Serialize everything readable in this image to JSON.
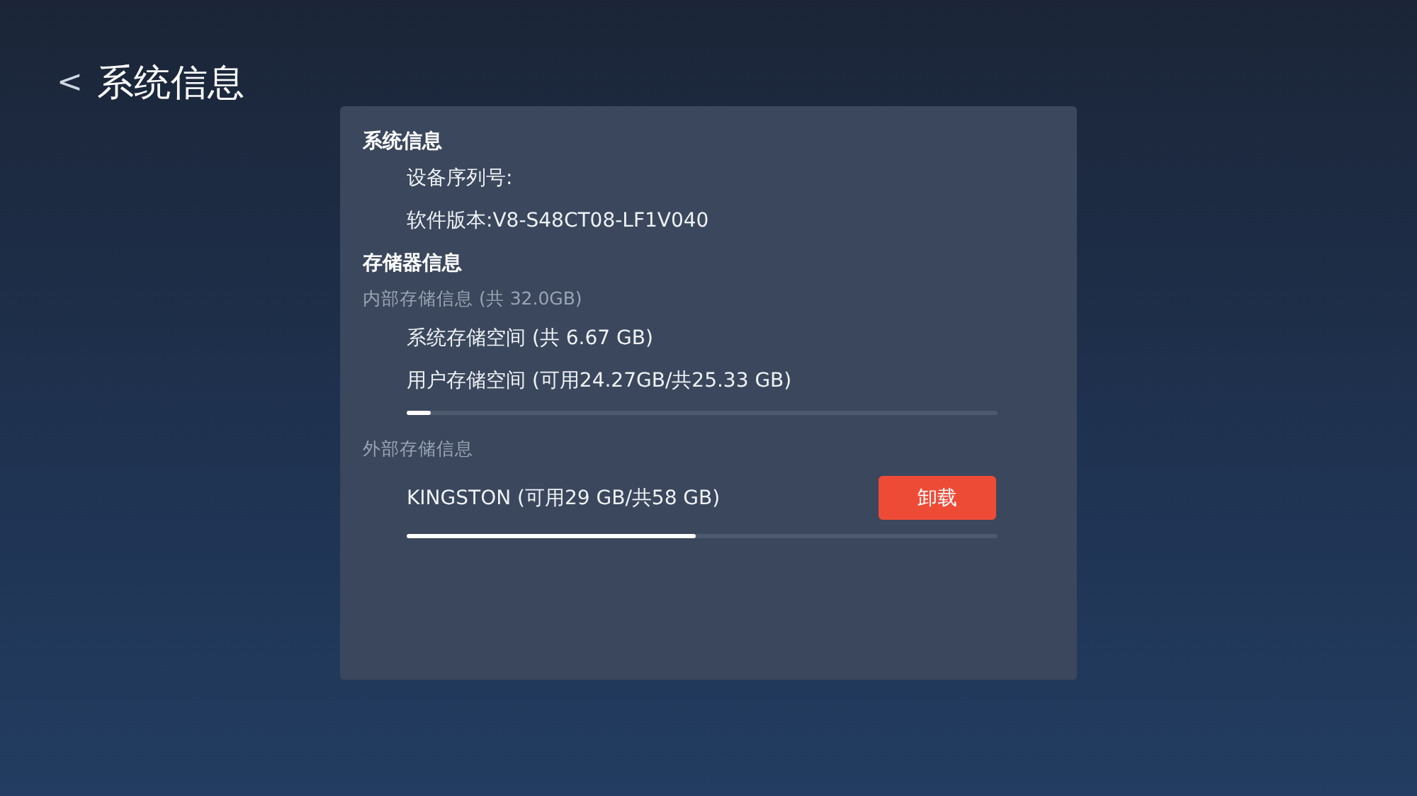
{
  "header": {
    "back": "<",
    "title": "系统信息"
  },
  "system": {
    "heading": "系统信息",
    "lines": [
      "设备序列号:",
      "软件版本:V8-S48CT08-LF1V040"
    ]
  },
  "storage": {
    "heading": "存储器信息",
    "internal": {
      "label": "内部存储信息 (共 32.0GB)",
      "lines": [
        "系统存储空间 (共 6.67 GB)",
        "用户存储空间 (可用24.27GB/共25.33 GB)"
      ],
      "level": 0.04
    },
    "external": {
      "label": "外部存储信息",
      "device": "KINGSTON (可用29 GB/共58 GB)",
      "button": "卸载",
      "level": 0.49
    }
  }
}
